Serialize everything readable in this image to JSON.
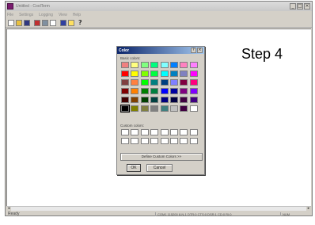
{
  "window": {
    "title": "Untitled - CoolTerm",
    "controls": [
      "_",
      "□",
      "×"
    ]
  },
  "menu": [
    "File",
    "Settings",
    "Logging",
    "View",
    "Help"
  ],
  "toolbar": {
    "icons": [
      "new-icon",
      "open-icon",
      "save-icon",
      "connect-icon",
      "disconnect-icon",
      "properties-icon",
      "clear-icon",
      "about-icon",
      "help-icon"
    ],
    "help_glyph": "?"
  },
  "step_label": "Step 4",
  "dialog": {
    "title": "Color",
    "title_buttons": [
      "?",
      "×"
    ],
    "basic_colors_label": "Basic colors:",
    "custom_colors_label": "Custom colors:",
    "define_custom_label": "Define Custom Colors >>",
    "ok_label": "OK",
    "cancel_label": "Cancel",
    "basic_colors": [
      [
        "#f08080",
        "#ffff80",
        "#80ff80",
        "#00ff80",
        "#80ffff",
        "#0080ff",
        "#ff80c0",
        "#ff80ff"
      ],
      [
        "#ff0000",
        "#ffff00",
        "#80ff00",
        "#00ff40",
        "#00ffff",
        "#0080c0",
        "#8080c0",
        "#ff00ff"
      ],
      [
        "#804040",
        "#ff8040",
        "#00ff00",
        "#008080",
        "#004080",
        "#8080ff",
        "#800040",
        "#ff0080"
      ],
      [
        "#800000",
        "#ff8000",
        "#008000",
        "#008040",
        "#0000ff",
        "#0000a0",
        "#800080",
        "#8000ff"
      ],
      [
        "#400000",
        "#804000",
        "#004000",
        "#004040",
        "#000080",
        "#000040",
        "#400040",
        "#400080"
      ],
      [
        "#000000",
        "#808000",
        "#808040",
        "#808080",
        "#408080",
        "#c0c0c0",
        "#400040",
        "#ffffff"
      ]
    ],
    "custom_colors": [
      [
        "#ffffff",
        "#ffffff",
        "#ffffff",
        "#ffffff",
        "#ffffff",
        "#ffffff",
        "#ffffff",
        "#ffffff"
      ],
      [
        "#ffffff",
        "#ffffff",
        "#ffffff",
        "#ffffff",
        "#ffffff",
        "#ffffff",
        "#ffffff",
        "#ffffff"
      ]
    ]
  },
  "status": {
    "ready": "Ready",
    "connection": "COM1 115200 8-N-1 DTR:0 CTS:0 DSR:1 CD:0 RI:0",
    "num": "NUM"
  }
}
